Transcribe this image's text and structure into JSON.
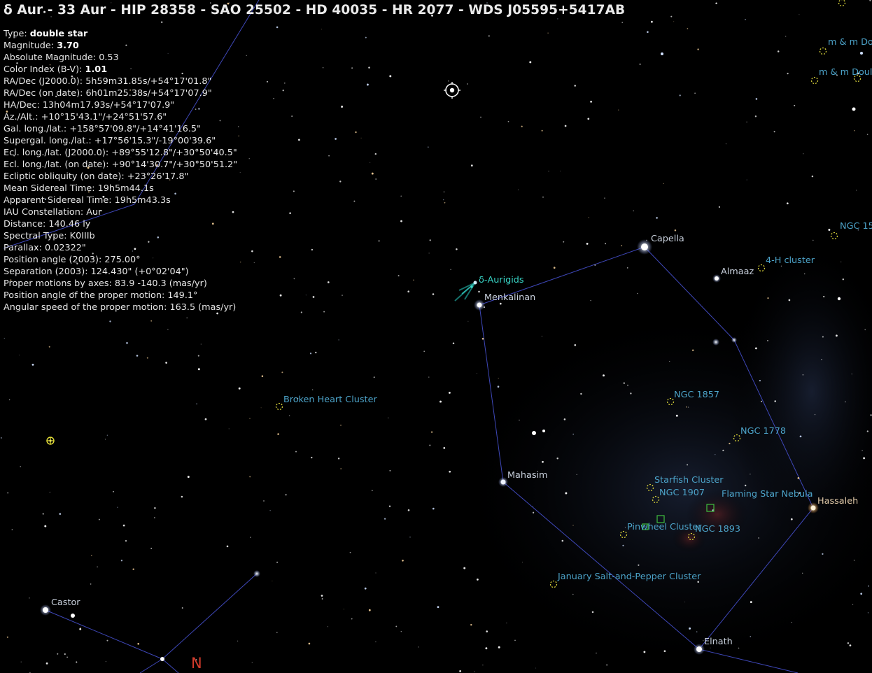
{
  "selected_object": {
    "title": "δ Aur - 33 Aur - HIP 28358 - SAO 25502 - HD 40035 - HR 2077 - WDS J05595+5417AB",
    "info": [
      {
        "label": "Type: ",
        "value": "double star",
        "bold": true
      },
      {
        "label": "Magnitude: ",
        "value": "3.70",
        "bold": true
      },
      {
        "label": "Absolute Magnitude: ",
        "value": "0.53"
      },
      {
        "label": "Color Index (B-V): ",
        "value": "1.01",
        "bold": true
      },
      {
        "label": "RA/Dec (J2000.0): ",
        "value": "5h59m31.85s/+54°17'01.8\""
      },
      {
        "label": "RA/Dec (on date): ",
        "value": "6h01m25.38s/+54°17'07.9\""
      },
      {
        "label": "HA/Dec: ",
        "value": "13h04m17.93s/+54°17'07.9\""
      },
      {
        "label": "Az./Alt.: ",
        "value": "+10°15'43.1\"/+24°51'57.6\""
      },
      {
        "label": "Gal. long./lat.: ",
        "value": "+158°57'09.8\"/+14°41'16.5\""
      },
      {
        "label": "Supergal. long./lat.: ",
        "value": "+17°56'15.3\"/-19°00'39.6\""
      },
      {
        "label": "Ecl. long./lat. (J2000.0): ",
        "value": "+89°55'12.8\"/+30°50'40.5\""
      },
      {
        "label": "Ecl. long./lat. (on date): ",
        "value": "+90°14'30.7\"/+30°50'51.2\""
      },
      {
        "label": "Ecliptic obliquity (on date): ",
        "value": "+23°26'17.8\""
      },
      {
        "label": "Mean Sidereal Time: ",
        "value": "19h5m44.1s"
      },
      {
        "label": "Apparent Sidereal Time: ",
        "value": "19h5m43.3s"
      },
      {
        "label": "IAU Constellation: ",
        "value": "Aur"
      },
      {
        "label": "Distance: ",
        "value": "140.46 ly"
      },
      {
        "label": "Spectral Type: ",
        "value": "K0IIIb"
      },
      {
        "label": "Parallax: ",
        "value": "0.02322\""
      },
      {
        "label": "Position angle (2003): ",
        "value": "275.00°"
      },
      {
        "label": "Separation (2003): ",
        "value": "124.430\" (+0°02'04\")"
      },
      {
        "label": "Proper motions by axes: ",
        "value": "83.9 -140.3 (mas/yr)"
      },
      {
        "label": "Position angle of the proper motion: ",
        "value": "149.1°"
      },
      {
        "label": "Angular speed of the proper motion: ",
        "value": "163.5 (mas/yr)"
      }
    ]
  },
  "star_labels": {
    "capella": "Capella",
    "almaaz": "Almaaz",
    "menkalinan": "Menkalinan",
    "mahasim": "Mahasim",
    "hassaleh": "Hassaleh",
    "elnath": "Elnath",
    "castor": "Castor"
  },
  "meteor_shower_label": "δ-Aurigids",
  "dso_labels": {
    "mm_double_1": "m & m Do",
    "mm_double_2": "m & m Doul",
    "ngc15": "NGC 15",
    "h4_cluster": "4-H cluster",
    "broken_heart": "Broken Heart Cluster",
    "ngc1857": "NGC 1857",
    "ngc1778": "NGC 1778",
    "starfish": "Starfish Cluster",
    "ngc1907": "NGC 1907",
    "flaming_star": "Flaming Star Nebula",
    "pinwheel": "Pinwheel Cluster",
    "ngc1893": "NGC 1893",
    "january_salt_pepper": "January Salt-and-Pepper Cluster"
  },
  "cardinal_label": "N",
  "colors": {
    "background": "#000000",
    "constellation_line": "#3e47b8",
    "dso_label": "#4ca3c9",
    "dso_marker": "#d8d23a",
    "nebula_marker": "#3fbf3f",
    "star_label": "#c8d0dc",
    "meteor_label": "#39d7c8",
    "cardinal": "#d23a2a"
  },
  "icons": {
    "selection": "target-ring-icon",
    "sun_symbol": "planet-symbol-icon"
  }
}
